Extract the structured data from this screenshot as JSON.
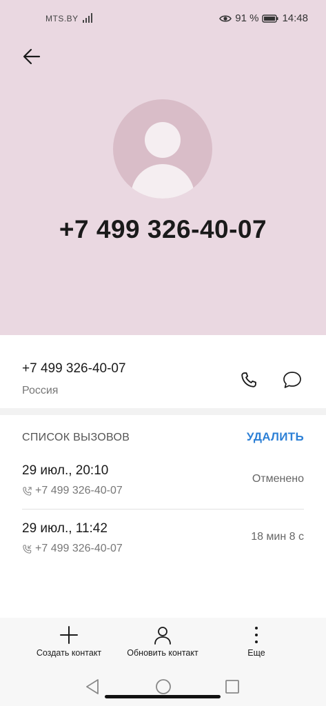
{
  "status_bar": {
    "carrier": "MTS.BY",
    "battery": "91 %",
    "time": "14:48"
  },
  "header": {
    "phone_number": "+7 499 326-40-07",
    "background_color": "#ead8e1"
  },
  "contact": {
    "number": "+7 499 326-40-07",
    "region": "Россия"
  },
  "call_log": {
    "title": "СПИСОК ВЫЗОВОВ",
    "delete_label": "УДАЛИТЬ",
    "entries": [
      {
        "date": "29 июл., 20:10",
        "number": "+7 499 326-40-07",
        "status": "Отменено",
        "icon": "outgoing-call-icon"
      },
      {
        "date": "29 июл., 11:42",
        "number": "+7 499 326-40-07",
        "status": "18 мин 8 с",
        "icon": "incoming-call-icon"
      }
    ]
  },
  "actions": {
    "create": "Создать контакт",
    "update": "Обновить контакт",
    "more": "Еще"
  },
  "colors": {
    "accent": "#2d80d6",
    "avatar": "#d9bdc8"
  }
}
